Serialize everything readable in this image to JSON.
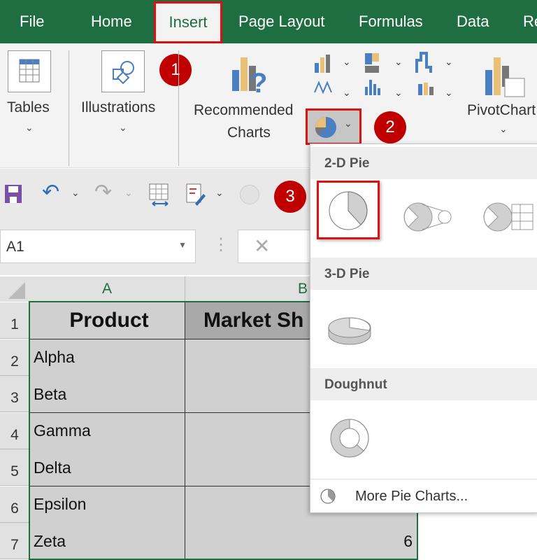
{
  "tabs": {
    "file": "File",
    "home": "Home",
    "insert": "Insert",
    "page_layout": "Page Layout",
    "formulas": "Formulas",
    "data": "Data",
    "review": "Re"
  },
  "ribbon": {
    "tables": "Tables",
    "illustrations": "Illustrations",
    "recommended_charts_1": "Recommended",
    "recommended_charts_2": "Charts",
    "pivotchart": "PivotChart"
  },
  "badges": {
    "b1": "1",
    "b2": "2",
    "b3": "3"
  },
  "name_box": "A1",
  "columns": [
    "A",
    "B"
  ],
  "rows": [
    {
      "n": "1",
      "a": "Product",
      "b": "Market Sh"
    },
    {
      "n": "2",
      "a": "Alpha",
      "b": ""
    },
    {
      "n": "3",
      "a": "Beta",
      "b": ""
    },
    {
      "n": "4",
      "a": "Gamma",
      "b": ""
    },
    {
      "n": "5",
      "a": "Delta",
      "b": ""
    },
    {
      "n": "6",
      "a": "Epsilon",
      "b": ""
    },
    {
      "n": "7",
      "a": "Zeta",
      "b": "6"
    }
  ],
  "dropdown": {
    "pie2d": "2-D Pie",
    "pie3d": "3-D Pie",
    "doughnut": "Doughnut",
    "more": "More Pie Charts..."
  },
  "colors": {
    "excel_green": "#1e6e42",
    "highlight_red": "#e01010",
    "badge_red": "#c00000"
  }
}
